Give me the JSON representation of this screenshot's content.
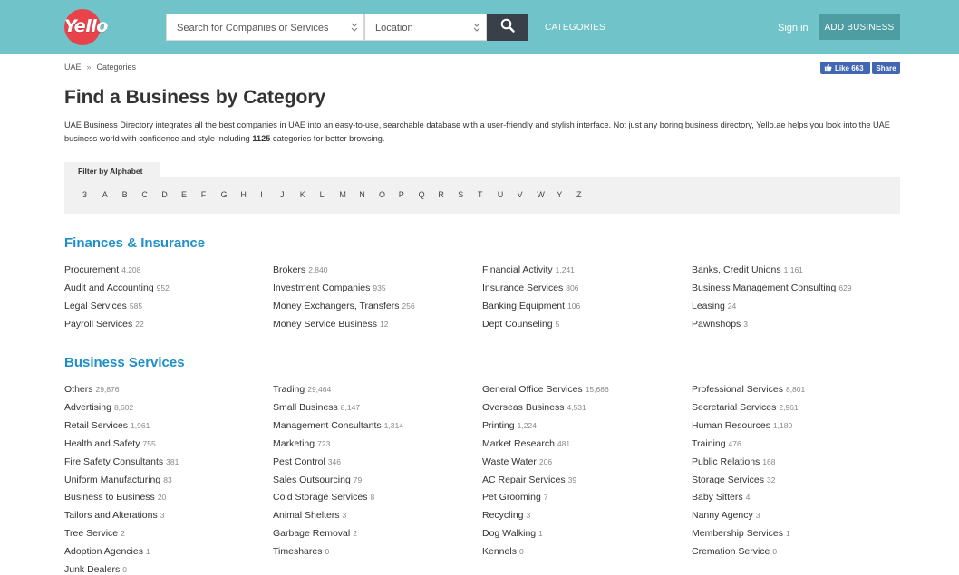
{
  "header": {
    "logo_text": "Yello",
    "search_placeholder": "Search for Companies or Services",
    "location_placeholder": "Location",
    "nav_categories": "CATEGORIES",
    "sign_in": "Sign in",
    "add_business": "ADD BUSINESS"
  },
  "breadcrumb": {
    "home": "UAE",
    "sep": "»",
    "current": "Categories"
  },
  "facebook": {
    "like_label": "Like 663",
    "share_label": "Share"
  },
  "page": {
    "title": "Find a Business by Category",
    "intro_before": "UAE Business Directory integrates all the best companies in UAE into an easy-to-use, searchable database with a user-friendly and stylish interface. Not just any boring business directory, Yello.ae helps you look into the UAE business world with confidence and style including ",
    "intro_count": "1125",
    "intro_after": " categories for better browsing."
  },
  "filter": {
    "label": "Filter by Alphabet",
    "letters": [
      "3",
      "A",
      "B",
      "C",
      "D",
      "E",
      "F",
      "G",
      "H",
      "I",
      "J",
      "K",
      "L",
      "M",
      "N",
      "O",
      "P",
      "Q",
      "R",
      "S",
      "T",
      "U",
      "V",
      "W",
      "Y",
      "Z"
    ]
  },
  "sections": [
    {
      "title": "Finances & Insurance",
      "items": [
        {
          "name": "Procurement",
          "count": "4,208"
        },
        {
          "name": "Brokers",
          "count": "2,840"
        },
        {
          "name": "Financial Activity",
          "count": "1,241"
        },
        {
          "name": "Banks, Credit Unions",
          "count": "1,161"
        },
        {
          "name": "Audit and Accounting",
          "count": "952"
        },
        {
          "name": "Investment Companies",
          "count": "935"
        },
        {
          "name": "Insurance Services",
          "count": "806"
        },
        {
          "name": "Business Management Consulting",
          "count": "629"
        },
        {
          "name": "Legal Services",
          "count": "585"
        },
        {
          "name": "Money Exchangers, Transfers",
          "count": "256"
        },
        {
          "name": "Banking Equipment",
          "count": "106"
        },
        {
          "name": "Leasing",
          "count": "24"
        },
        {
          "name": "Payroll Services",
          "count": "22"
        },
        {
          "name": "Money Service Business",
          "count": "12"
        },
        {
          "name": "Dept Counseling",
          "count": "5"
        },
        {
          "name": "Pawnshops",
          "count": "3"
        }
      ]
    },
    {
      "title": "Business Services",
      "items": [
        {
          "name": "Others",
          "count": "29,876"
        },
        {
          "name": "Trading",
          "count": "29,464"
        },
        {
          "name": "General Office Services",
          "count": "15,686"
        },
        {
          "name": "Professional Services",
          "count": "8,801"
        },
        {
          "name": "Advertising",
          "count": "8,602"
        },
        {
          "name": "Small Business",
          "count": "8,147"
        },
        {
          "name": "Overseas Business",
          "count": "4,531"
        },
        {
          "name": "Secretarial Services",
          "count": "2,961"
        },
        {
          "name": "Retail Services",
          "count": "1,961"
        },
        {
          "name": "Management Consultants",
          "count": "1,314"
        },
        {
          "name": "Printing",
          "count": "1,224"
        },
        {
          "name": "Human Resources",
          "count": "1,180"
        },
        {
          "name": "Health and Safety",
          "count": "755"
        },
        {
          "name": "Marketing",
          "count": "723"
        },
        {
          "name": "Market Research",
          "count": "481"
        },
        {
          "name": "Training",
          "count": "476"
        },
        {
          "name": "Fire Safety Consultants",
          "count": "381"
        },
        {
          "name": "Pest Control",
          "count": "346"
        },
        {
          "name": "Waste Water",
          "count": "206"
        },
        {
          "name": "Public Relations",
          "count": "168"
        },
        {
          "name": "Uniform Manufacturing",
          "count": "83"
        },
        {
          "name": "Sales Outsourcing",
          "count": "79"
        },
        {
          "name": "AC Repair Services",
          "count": "39"
        },
        {
          "name": "Storage Services",
          "count": "32"
        },
        {
          "name": "Business to Business",
          "count": "20"
        },
        {
          "name": "Cold Storage Services",
          "count": "8"
        },
        {
          "name": "Pet Grooming",
          "count": "7"
        },
        {
          "name": "Baby Sitters",
          "count": "4"
        },
        {
          "name": "Tailors and Alterations",
          "count": "3"
        },
        {
          "name": "Animal Shelters",
          "count": "3"
        },
        {
          "name": "Recycling",
          "count": "3"
        },
        {
          "name": "Nanny Agency",
          "count": "3"
        },
        {
          "name": "Tree Service",
          "count": "2"
        },
        {
          "name": "Garbage Removal",
          "count": "2"
        },
        {
          "name": "Dog Walking",
          "count": "1"
        },
        {
          "name": "Membership Services",
          "count": "1"
        },
        {
          "name": "Adoption Agencies",
          "count": "1"
        },
        {
          "name": "Timeshares",
          "count": "0"
        },
        {
          "name": "Kennels",
          "count": "0"
        },
        {
          "name": "Cremation Service",
          "count": "0"
        },
        {
          "name": "Junk Dealers",
          "count": "0"
        }
      ]
    }
  ],
  "colors": {
    "header_bg": "#6fc3c9",
    "logo_red": "#e8434b",
    "section_title": "#1e8fc8",
    "add_business_bg": "#4d9da3",
    "search_button_bg": "#3a4049"
  }
}
